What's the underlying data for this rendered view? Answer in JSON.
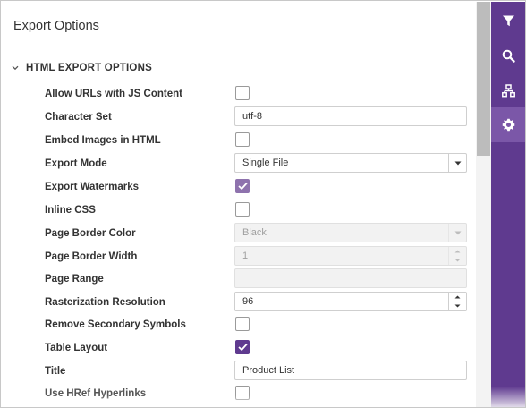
{
  "panel": {
    "title": "Export Options"
  },
  "group": {
    "title": "HTML EXPORT OPTIONS"
  },
  "options": {
    "allow_urls_js": {
      "label": "Allow URLs with JS Content",
      "checked": false
    },
    "character_set": {
      "label": "Character Set",
      "value": "utf-8"
    },
    "embed_images": {
      "label": "Embed Images in HTML",
      "checked": false
    },
    "export_mode": {
      "label": "Export Mode",
      "value": "Single File"
    },
    "export_watermarks": {
      "label": "Export Watermarks",
      "checked": true
    },
    "inline_css": {
      "label": "Inline CSS",
      "checked": false
    },
    "page_border_color": {
      "label": "Page Border Color",
      "value": "Black",
      "disabled": true
    },
    "page_border_width": {
      "label": "Page Border Width",
      "value": "1",
      "disabled": true
    },
    "page_range": {
      "label": "Page Range",
      "value": "",
      "disabled": true
    },
    "rasterization_resolution": {
      "label": "Rasterization Resolution",
      "value": "96"
    },
    "remove_secondary_symbols": {
      "label": "Remove Secondary Symbols",
      "checked": false
    },
    "table_layout": {
      "label": "Table Layout",
      "checked": true
    },
    "title": {
      "label": "Title",
      "value": "Product List"
    },
    "use_href_hyperlinks": {
      "label": "Use HRef Hyperlinks",
      "checked": false
    }
  },
  "side_nav": {
    "items": [
      {
        "icon": "filter-icon"
      },
      {
        "icon": "search-icon"
      },
      {
        "icon": "document-map-icon"
      },
      {
        "icon": "gear-icon",
        "active": true
      }
    ]
  },
  "colors": {
    "accent": "#5f3a8f",
    "accent_active": "#7b57a8"
  }
}
